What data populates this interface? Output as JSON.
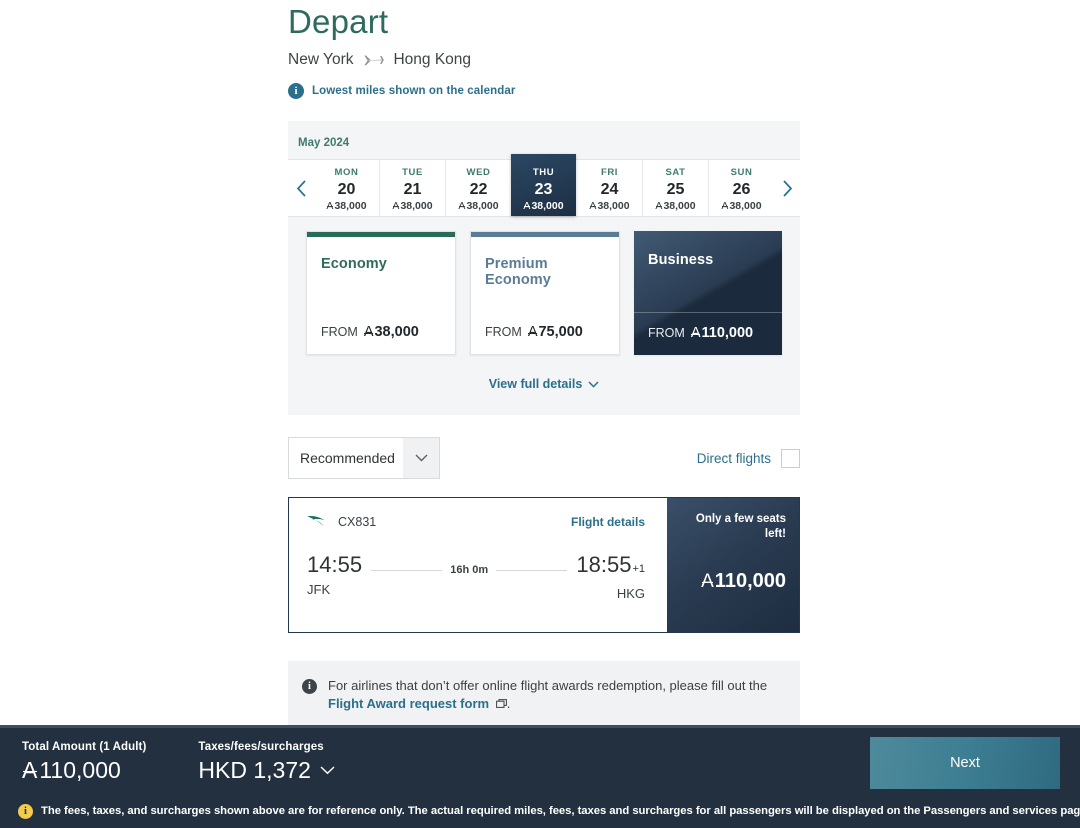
{
  "header": {
    "title": "Depart",
    "origin": "New York",
    "destination": "Hong Kong",
    "plane_icon": "airplane-icon",
    "info_icon": "info-circle-icon",
    "info_text": "Lowest miles shown on the calendar"
  },
  "calendar": {
    "month": "May 2024",
    "prev_icon": "chevron-left-icon",
    "next_icon": "chevron-right-icon",
    "miles_symbol": "A",
    "days": [
      {
        "dow": "MON",
        "num": "20",
        "miles": "38,000",
        "selected": false
      },
      {
        "dow": "TUE",
        "num": "21",
        "miles": "38,000",
        "selected": false
      },
      {
        "dow": "WED",
        "num": "22",
        "miles": "38,000",
        "selected": false
      },
      {
        "dow": "THU",
        "num": "23",
        "miles": "38,000",
        "selected": true
      },
      {
        "dow": "FRI",
        "num": "24",
        "miles": "38,000",
        "selected": false
      },
      {
        "dow": "SAT",
        "num": "25",
        "miles": "38,000",
        "selected": false
      },
      {
        "dow": "SUN",
        "num": "26",
        "miles": "38,000",
        "selected": false
      }
    ]
  },
  "cabins": {
    "from_label": "FROM",
    "items": [
      {
        "name": "Economy",
        "price": "38,000",
        "accent": "#2a6a5b",
        "selected": false
      },
      {
        "name": "Premium Economy",
        "price": "75,000",
        "accent": "#5b7c96",
        "selected": false
      },
      {
        "name": "Business",
        "price": "110,000",
        "accent": "#1d2c3e",
        "selected": true
      }
    ],
    "view_details_label": "View full details",
    "view_details_icon": "chevron-down-icon"
  },
  "filters": {
    "sort_value": "Recommended",
    "sort_chevron_icon": "chevron-down-icon",
    "direct_label": "Direct flights",
    "direct_checked": false
  },
  "flight": {
    "airline_logo_icon": "cathay-brushwing-icon",
    "flight_number": "CX831",
    "details_link": "Flight details",
    "depart_time": "14:55",
    "depart_airport": "JFK",
    "duration": "16h 0m",
    "arrive_time": "18:55",
    "arrive_day_offset": "+1",
    "arrive_airport": "HKG",
    "seats_notice": "Only a few seats left!",
    "price": "110,000",
    "miles_symbol": "A"
  },
  "notice": {
    "icon": "info-circle-icon",
    "text_before": "For airlines that don’t offer online flight awards redemption, please fill out the",
    "link_text": "Flight Award request form",
    "external_icon": "external-window-icon",
    "text_after": "."
  },
  "bottom": {
    "total_label": "Total Amount (1 Adult)",
    "total_value": "110,000",
    "total_symbol": "A",
    "taxes_label": "Taxes/fees/surcharges",
    "taxes_value": "HKD 1,372",
    "taxes_chevron_icon": "chevron-down-icon",
    "next_label": "Next",
    "warning_icon": "info-circle-icon",
    "disclaimer": "The fees, taxes, and surcharges shown above are for reference only. The actual required miles, fees, taxes and surcharges for all passengers will be displayed on the Passengers and services page."
  }
}
